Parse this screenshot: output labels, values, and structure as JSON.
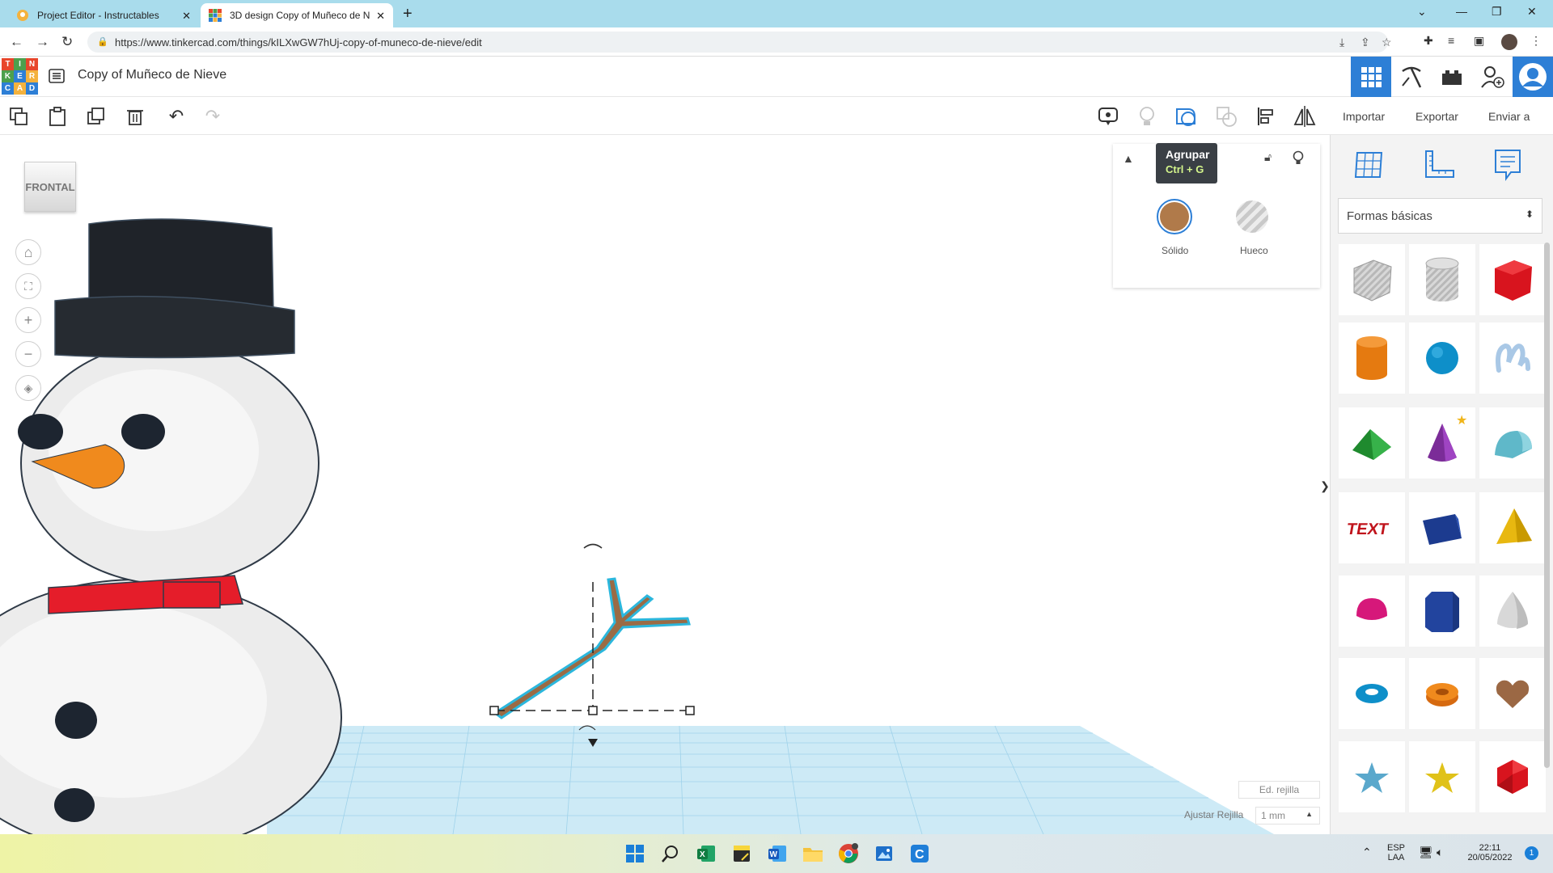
{
  "browser": {
    "tabs": [
      {
        "title": "Project Editor - Instructables",
        "active": false
      },
      {
        "title": "3D design Copy of Muñeco de N",
        "active": true
      }
    ],
    "new_tab": "+",
    "url": "https://www.tinkercad.com/things/kILXwGW7hUj-copy-of-muneco-de-nieve/edit"
  },
  "app": {
    "logo_letters": [
      "T",
      "I",
      "N",
      "K",
      "E",
      "R",
      "C",
      "A",
      "D"
    ],
    "design_title": "Copy of Muñeco de Nieve",
    "toolbar": {
      "import_label": "Importar",
      "export_label": "Exportar",
      "send_label": "Enviar a"
    },
    "viewcube_label": "FRONTAL",
    "tooltip": {
      "title": "Agrupar",
      "shortcut": "Ctrl + G"
    },
    "inspector": {
      "solid_label": "Sólido",
      "hole_label": "Hueco",
      "solid_color": "#b07a4a"
    },
    "shapes_panel": {
      "category": "Formas básicas",
      "shapes": [
        "box-hole",
        "cylinder-hole",
        "box",
        "cylinder",
        "sphere",
        "scribble",
        "roof",
        "cone",
        "round-roof",
        "text",
        "wedge",
        "pyramid",
        "half-sphere",
        "polygon",
        "paraboloid",
        "torus",
        "tube",
        "heart",
        "star",
        "star-gold",
        "icosahedron"
      ]
    },
    "edit_grid_label": "Ed. rejilla",
    "snap_grid_label": "Ajustar Rejilla",
    "snap_grid_value": "1 mm",
    "panel_toggle": "❯"
  },
  "taskbar": {
    "language": "ESP",
    "keyboard": "LAA",
    "time": "22:11",
    "date": "20/05/2022",
    "notifications": "1"
  },
  "colors": {
    "tab_strip": "#a9dcec",
    "accent_blue": "#2d7fd6",
    "grid_blue": "#cdeaf6"
  }
}
